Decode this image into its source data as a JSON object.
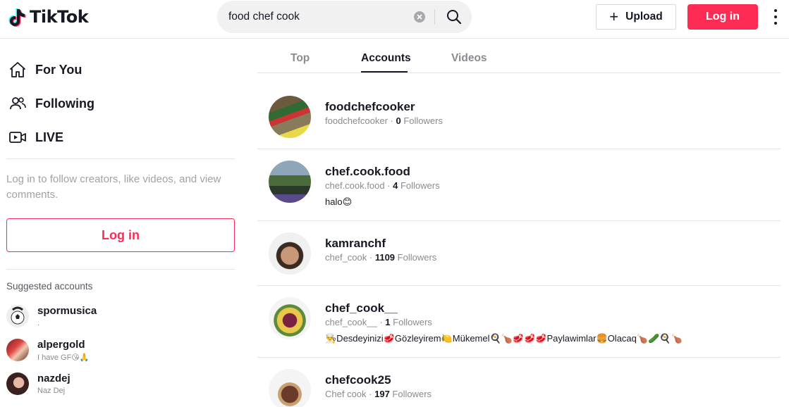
{
  "header": {
    "logo_text": "TikTok",
    "search_value": "food chef cook",
    "upload_label": "Upload",
    "login_label": "Log in"
  },
  "sidebar": {
    "nav": [
      {
        "label": "For You",
        "icon": "home-icon"
      },
      {
        "label": "Following",
        "icon": "users-icon"
      },
      {
        "label": "LIVE",
        "icon": "live-camera-icon"
      }
    ],
    "login_hint": "Log in to follow creators, like videos, and view comments.",
    "login_label": "Log in",
    "suggested_title": "Suggested accounts",
    "suggested": [
      {
        "username": "spormusica",
        "nickname": "."
      },
      {
        "username": "alpergold",
        "nickname": "I have GF😘🙏"
      },
      {
        "username": "nazdej",
        "nickname": "Naz Dej"
      }
    ]
  },
  "tabs": {
    "top": "Top",
    "accounts": "Accounts",
    "videos": "Videos",
    "active": "Accounts"
  },
  "accounts": [
    {
      "username": "foodchefcooker",
      "handle": "foodchefcooker",
      "sep": " · ",
      "followers": "0",
      "followers_label": " Followers",
      "bio": ""
    },
    {
      "username": "chef.cook.food",
      "handle": "chef.cook.food",
      "sep": " · ",
      "followers": "4",
      "followers_label": " Followers",
      "bio": "halo😊"
    },
    {
      "username": "kamranchf",
      "handle": "chef_cook",
      "sep": " · ",
      "followers": "1109",
      "followers_label": " Followers",
      "bio": ""
    },
    {
      "username": "chef_cook__",
      "handle": "chef_cook__",
      "sep": " · ",
      "followers": "1",
      "followers_label": " Followers",
      "bio": "👨‍🍳Desdeyinizi🥩Gözleyirem🍋Mükemel🍳🍗🥩🥩🥩Paylawimlar🍔Olacaq🍗🥒🍳🍗"
    },
    {
      "username": "chefcook25",
      "handle": "Chef cook",
      "sep": " · ",
      "followers": "197",
      "followers_label": " Followers",
      "bio": ""
    }
  ],
  "colors": {
    "brand": "#fe2c55",
    "text": "#161823",
    "muted": "#8a8b91",
    "divider": "#e3e3e4"
  }
}
